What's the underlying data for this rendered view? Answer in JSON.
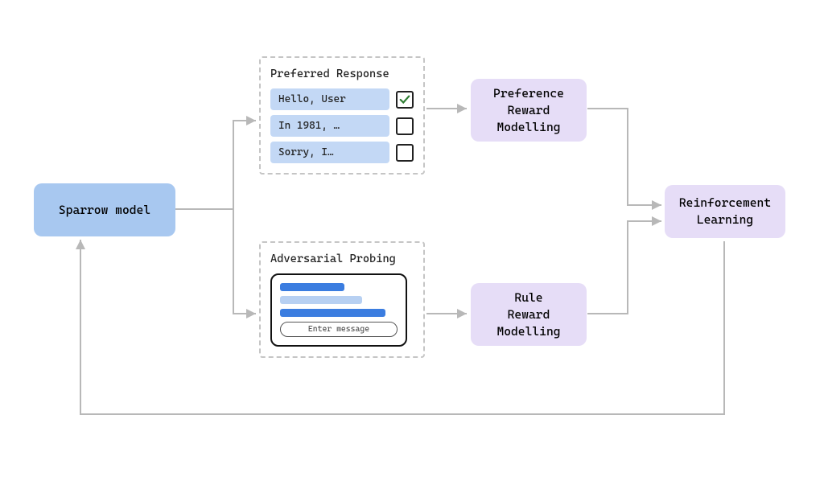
{
  "nodes": {
    "sparrow": {
      "label": "Sparrow model"
    },
    "preference_rm": {
      "label": "Preference\nReward\nModelling"
    },
    "rule_rm": {
      "label": "Rule\nReward\nModelling"
    },
    "rl": {
      "label": "Reinforcement\nLearning"
    }
  },
  "panels": {
    "preferred": {
      "title": "Preferred Response",
      "responses": [
        {
          "text": "Hello, User",
          "checked": true
        },
        {
          "text": "In 1981, …",
          "checked": false
        },
        {
          "text": "Sorry, I…",
          "checked": false
        }
      ]
    },
    "adversarial": {
      "title": "Adversarial Probing",
      "chat_placeholder": "Enter message"
    }
  },
  "colors": {
    "blue_node": "#a8c8f0",
    "purple_node": "#e6ddf7",
    "arrow": "#b8b8b8",
    "check": "#2e7d32"
  }
}
